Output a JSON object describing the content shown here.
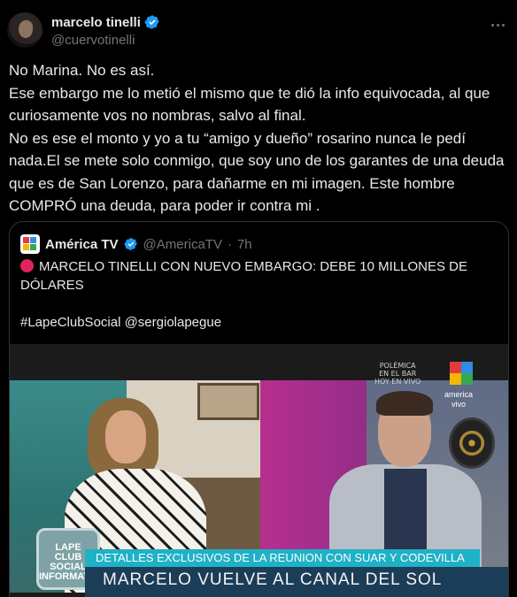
{
  "author": {
    "display_name": "marcelo tinelli",
    "handle": "@cuervotinelli",
    "verified_color": "#1d9bf0"
  },
  "tweet": {
    "text": "No Marina. No es así.\nEse embargo me lo metió el mismo que te dió la info equivocada, al que curiosamente vos no nombras, salvo al final.\nNo es ese el monto y yo a tu “amigo y dueño” rosarino nunca le pedí nada.El se mete solo conmigo, que soy uno de los garantes de una deuda que es de San Lorenzo, para dañarme en mi imagen. Este hombre COMPRÓ una deuda, para poder ir contra mi ."
  },
  "quote": {
    "display_name": "América TV",
    "handle": "@AmericaTV",
    "separator": "·",
    "time": "7h",
    "text_line1": "MARCELO TINELLI CON NUEVO EMBARGO: DEBE 10 MILLONES DE DÓLARES",
    "hashtags": "#LapeClubSocial @sergiolapegue"
  },
  "video": {
    "overlay_small": "POLÉMICA\nEN EL BAR\nHOY EN VIVO",
    "channel_label": "america\nvivo",
    "badge": "LAPE\nCLUB\nSOCIAL\nINFORMATIVO",
    "strip_text": "DETALLES EXCLUSIVOS DE LA REUNION CON SUAR Y CODEVILLA",
    "bottom_text": "MARCELO VUELVE AL CANAL DEL SOL"
  }
}
